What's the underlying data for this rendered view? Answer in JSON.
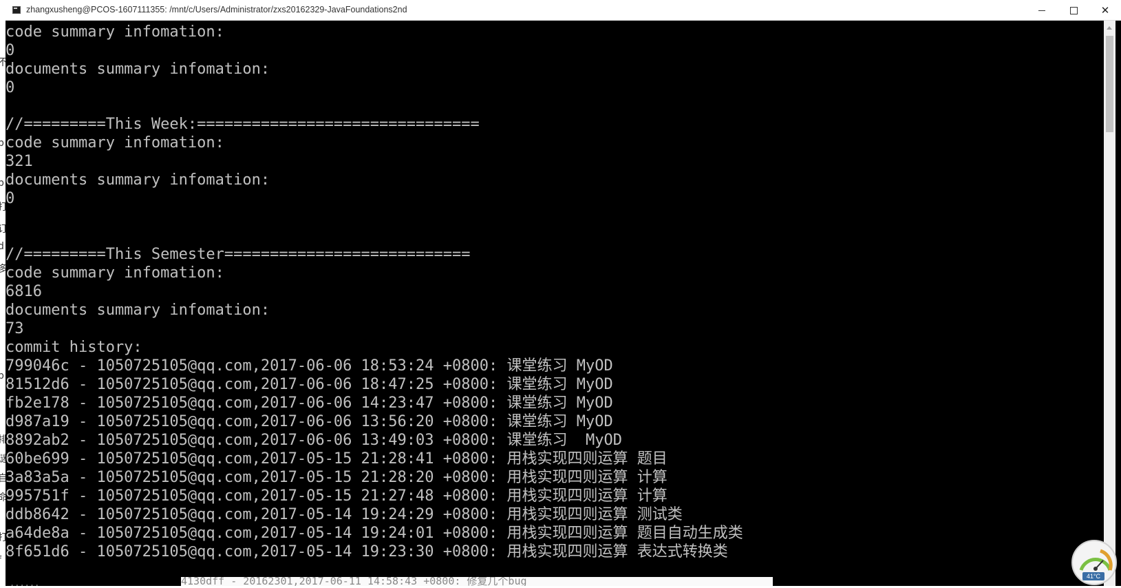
{
  "window": {
    "title": "zhangxusheng@PCOS-1607111355: /mnt/c/Users/Administrator/zxs20162329-JavaFoundations2nd",
    "controls": {
      "minimize": "minimize",
      "maximize": "maximize",
      "close": "✕"
    }
  },
  "terminal": {
    "lines": [
      "code summary infomation:",
      "0",
      "documents summary infomation:",
      "0",
      "",
      "//=========This Week:===============================",
      "code summary infomation:",
      "321",
      "documents summary infomation:",
      "0",
      "",
      "",
      "//=========This Semester===========================",
      "code summary infomation:",
      "6816",
      "documents summary infomation:",
      "73",
      "commit history:",
      "799046c - 1050725105@qq.com,2017-06-06 18:53:24 +0800: 课堂练习 MyOD",
      "81512d6 - 1050725105@qq.com,2017-06-06 18:47:25 +0800: 课堂练习 MyOD",
      "fb2e178 - 1050725105@qq.com,2017-06-06 14:23:47 +0800: 课堂练习 MyOD",
      "d987a19 - 1050725105@qq.com,2017-06-06 13:56:20 +0800: 课堂练习 MyOD",
      "8892ab2 - 1050725105@qq.com,2017-06-06 13:49:03 +0800: 课堂练习  MyOD",
      "60be699 - 1050725105@qq.com,2017-05-15 21:28:41 +0800: 用栈实现四则运算 题目",
      "3a83a5a - 1050725105@qq.com,2017-05-15 21:28:20 +0800: 用栈实现四则运算 计算",
      "995751f - 1050725105@qq.com,2017-05-15 21:27:48 +0800: 用栈实现四则运算 计算",
      "ddb8642 - 1050725105@qq.com,2017-05-14 19:24:29 +0800: 用栈实现四则运算 测试类",
      "a64de8a - 1050725105@qq.com,2017-05-14 19:24:01 +0800: 用栈实现四则运算 题目自动生成类",
      "8f651d6 - 1050725105@qq.com,2017-05-14 19:23:30 +0800: 用栈实现四则运算 表达式转换类"
    ]
  },
  "background": {
    "bottom_overlay_text": "4130dff - 20162301,2017-06-11 14:58:43 +0800: 修复几个bug",
    "bottom_left_text": "......",
    "left_strip_glyphs": [
      "不",
      "b",
      "p",
      "打",
      "订",
      "d",
      "多",
      "p",
      "排",
      "谜",
      "自",
      "命",
      "打",
      "f"
    ]
  },
  "gauge": {
    "temperature": "41°C",
    "icon": "speed-gauge-icon"
  },
  "colors": {
    "terminal_bg": "#000000",
    "terminal_fg": "#c0c0c0",
    "titlebar_bg": "#ffffff"
  }
}
